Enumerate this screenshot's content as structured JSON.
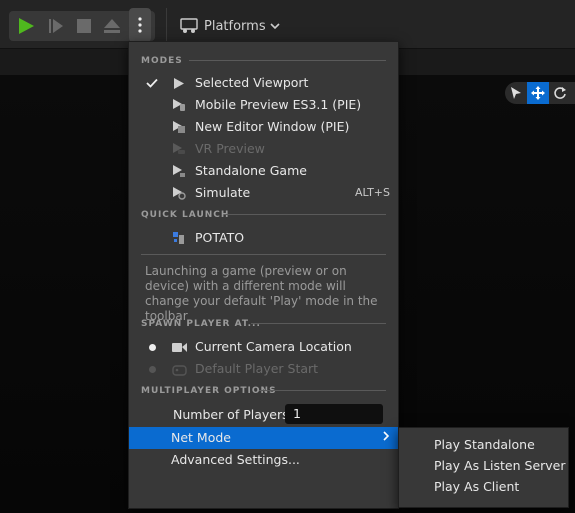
{
  "toolbar": {
    "platforms_label": "Platforms"
  },
  "menu": {
    "modes_header": "MODES",
    "modes": [
      {
        "label": "Selected Viewport",
        "checked": true,
        "disabled": false,
        "shortcut": "",
        "icon": "play-icon"
      },
      {
        "label": "Mobile Preview ES3.1 (PIE)",
        "checked": false,
        "disabled": false,
        "shortcut": "",
        "icon": "mobile-preview-icon"
      },
      {
        "label": "New Editor Window (PIE)",
        "checked": false,
        "disabled": false,
        "shortcut": "",
        "icon": "new-window-icon"
      },
      {
        "label": "VR Preview",
        "checked": false,
        "disabled": true,
        "shortcut": "",
        "icon": "vr-preview-icon"
      },
      {
        "label": "Standalone Game",
        "checked": false,
        "disabled": false,
        "shortcut": "",
        "icon": "standalone-game-icon"
      },
      {
        "label": "Simulate",
        "checked": false,
        "disabled": false,
        "shortcut": "ALT+S",
        "icon": "simulate-icon"
      }
    ],
    "quick_launch_header": "QUICK LAUNCH",
    "quick_launch_item": "POTATO",
    "description": "Launching a game (preview or on device) with a different mode will change your default 'Play' mode in the toolbar",
    "spawn_header": "SPAWN PLAYER AT...",
    "spawn": [
      {
        "label": "Current Camera Location",
        "selected": true,
        "disabled": false
      },
      {
        "label": "Default Player Start",
        "selected": false,
        "disabled": true
      }
    ],
    "multiplayer_header": "MULTIPLAYER OPTIONS",
    "players_label": "Number of Players",
    "players_value": "1",
    "net_mode_label": "Net Mode",
    "advanced_label": "Advanced Settings..."
  },
  "net_mode_submenu": [
    {
      "label": "Play Standalone",
      "selected": false
    },
    {
      "label": "Play As Listen Server",
      "selected": false
    },
    {
      "label": "Play As Client",
      "selected": true
    }
  ],
  "colors": {
    "accent": "#0a6bd0",
    "play_green": "#4fb81e",
    "menu_bg": "#383838"
  }
}
